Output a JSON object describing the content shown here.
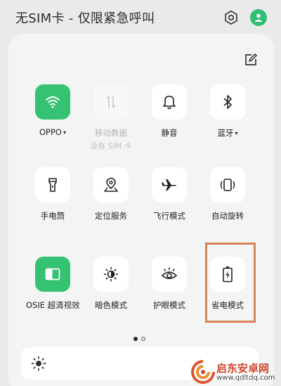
{
  "status_bar": {
    "carrier_text": "无SIM卡 - 仅限紧急呼叫"
  },
  "tiles": [
    {
      "label": "OPPO",
      "caret": "▾",
      "icon": "wifi-icon",
      "state": "active"
    },
    {
      "label": "移动数据",
      "sublabel": "没有 SIM 卡",
      "icon": "mobile-data-icon",
      "state": "disabled"
    },
    {
      "label": "静音",
      "icon": "bell-icon",
      "state": "off"
    },
    {
      "label": "蓝牙",
      "caret": "▾",
      "icon": "bluetooth-icon",
      "state": "off"
    },
    {
      "label": "手电筒",
      "icon": "flashlight-icon",
      "state": "off"
    },
    {
      "label": "定位服务",
      "icon": "location-icon",
      "state": "off"
    },
    {
      "label": "飞行模式",
      "icon": "airplane-icon",
      "state": "off"
    },
    {
      "label": "自动旋转",
      "icon": "auto-rotate-icon",
      "state": "off"
    },
    {
      "label": "OSIE 超清视效",
      "icon": "osie-icon",
      "state": "active"
    },
    {
      "label": "暗色模式",
      "icon": "dark-mode-icon",
      "state": "off"
    },
    {
      "label": "护眼模式",
      "icon": "eye-icon",
      "state": "off"
    },
    {
      "label": "省电模式",
      "icon": "battery-saver-icon",
      "state": "off"
    }
  ],
  "pagination": {
    "current": 1,
    "total": 2
  },
  "brightness": {
    "icon": "sun-icon"
  },
  "watermark": {
    "title": "启东安卓网",
    "url": "www.qdltdq.com"
  },
  "colors": {
    "accent": "#35c272",
    "highlight": "#d9825a",
    "watermark": "#d2452c"
  }
}
